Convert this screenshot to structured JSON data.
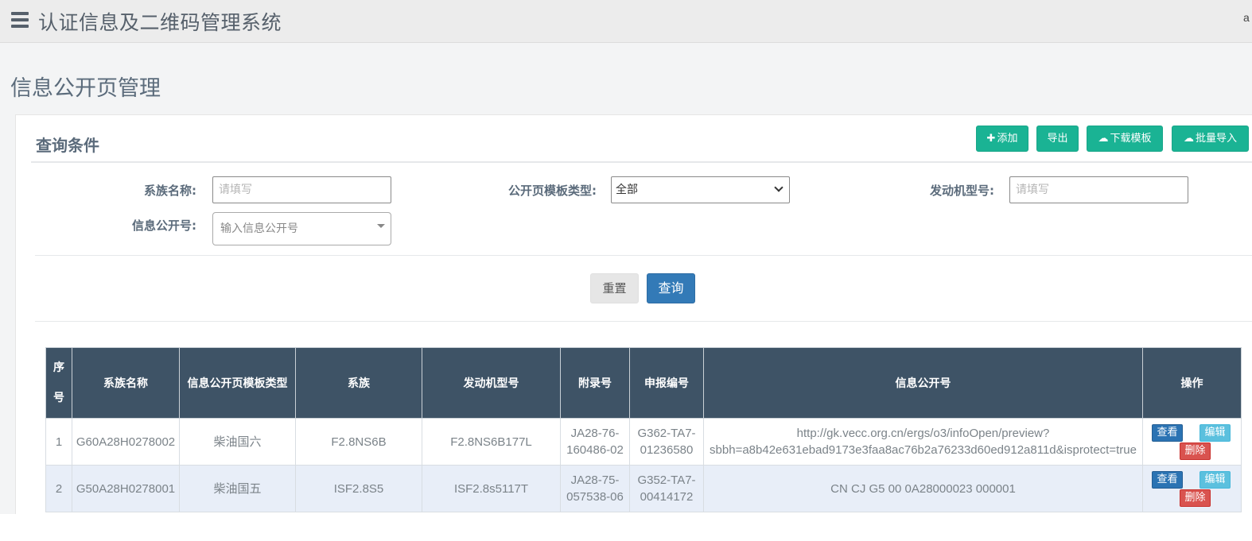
{
  "header": {
    "app_title": "认证信息及二维码管理系统",
    "user_text": "a",
    "menu_icon": "hamburger-menu-icon"
  },
  "page": {
    "title": "信息公开页管理"
  },
  "query_panel": {
    "title": "查询条件",
    "actions": [
      {
        "label": "添加",
        "icon": "plus-icon"
      },
      {
        "label": "导出"
      },
      {
        "label": "下载模板",
        "icon": "cloud-download-icon"
      },
      {
        "label": "批量导入",
        "icon": "cloud-upload-icon"
      }
    ],
    "fields": {
      "family_name": {
        "label": "系族名称:",
        "placeholder": "请填写",
        "value": ""
      },
      "template_type": {
        "label": "公开页模板类型:",
        "value": "全部"
      },
      "engine_model": {
        "label": "发动机型号:",
        "placeholder": "请填写",
        "value": ""
      },
      "info_no": {
        "label": "信息公开号:",
        "placeholder": "输入信息公开号"
      }
    },
    "reset_label": "重置",
    "query_label": "查询"
  },
  "table": {
    "columns": [
      "序号",
      "系族名称",
      "信息公开页模板类型",
      "系族",
      "发动机型号",
      "附录号",
      "申报编号",
      "信息公开号",
      "操作"
    ],
    "row_actions": {
      "view": "查看",
      "edit": "编辑",
      "delete": "删除"
    },
    "rows": [
      {
        "seq": "1",
        "family_name": "G60A28H0278002",
        "template_type": "柴油国六",
        "family": "F2.8NS6B",
        "engine_model": "F2.8NS6B177L",
        "appendix_no_1": "JA28-76-",
        "appendix_no_2": "160486-02",
        "declare_no_1": "G362-TA7-",
        "declare_no_2": "01236580",
        "info_no_1": "http://gk.vecc.org.cn/ergs/o3/infoOpen/preview?",
        "info_no_2": "sbbh=a8b42e631ebad9173e3faa8ac76b2a76233d60ed912a811d&isprotect=true"
      },
      {
        "seq": "2",
        "family_name": "G50A28H0278001",
        "template_type": "柴油国五",
        "family": "ISF2.8S5",
        "engine_model": "ISF2.8s5117T",
        "appendix_no_1": "JA28-75-",
        "appendix_no_2": "057538-06",
        "declare_no_1": "G352-TA7-",
        "declare_no_2": "00414172",
        "info_no_1": "CN CJ G5 00 0A28000023 000001",
        "info_no_2": ""
      }
    ]
  }
}
